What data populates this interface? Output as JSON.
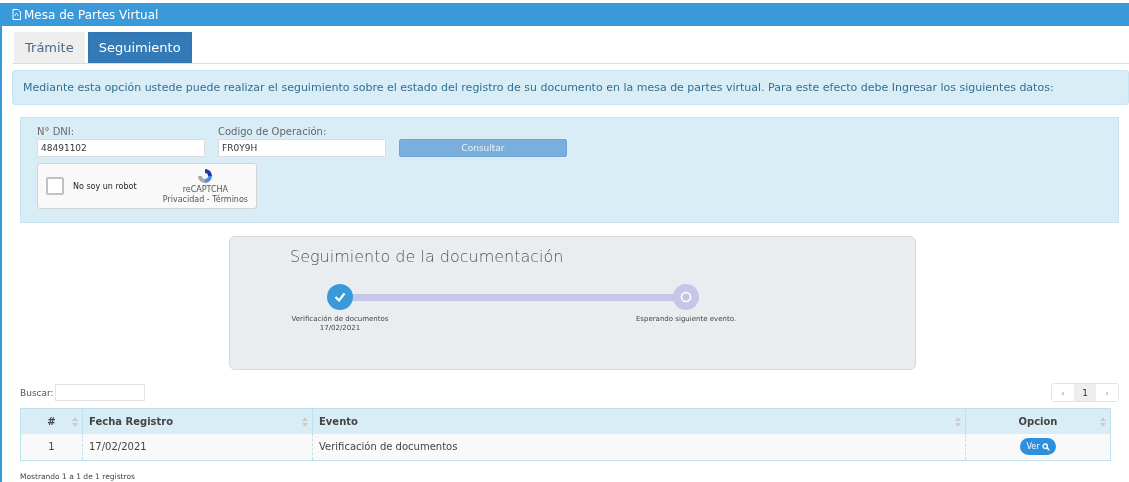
{
  "window": {
    "title": "Mesa de Partes Virtual"
  },
  "tabs": [
    {
      "label": "Trámite",
      "selected": false
    },
    {
      "label": "Seguimiento",
      "selected": true
    }
  ],
  "info": "Mediante esta opción ustede puede realizar el seguimiento sobre el estado del registro de su documento en la mesa de partes virtual. Para este efecto debe Ingresar los siguientes datos:",
  "form": {
    "dni": {
      "label": "N° DNI:",
      "value": "48491102"
    },
    "code": {
      "label": "Codigo de Operación:",
      "value": "FR0Y9H"
    },
    "button": "Consultar",
    "captcha": {
      "label": "No soy un robot",
      "checked": false,
      "brand": "reCAPTCHA",
      "links": "Privacidad - Términos"
    }
  },
  "tracking": {
    "title": "Seguimiento de la documentación",
    "steps": [
      {
        "kind": "done",
        "label": "Verificación de documentos",
        "date": "17/02/2021"
      },
      {
        "kind": "pending",
        "label": "Esperando siguiente evento."
      }
    ]
  },
  "search": {
    "label": "Buscar:"
  },
  "pagination": {
    "prev": "‹",
    "next": "›",
    "pages": [
      {
        "label": "1",
        "selected": true
      }
    ]
  },
  "table": {
    "columns": [
      {
        "label": "#"
      },
      {
        "label": "Fecha Registro"
      },
      {
        "label": "Evento"
      },
      {
        "label": "Opcion"
      }
    ],
    "rows": [
      {
        "cells": [
          "1",
          "17/02/2021",
          "Verificación de documentos"
        ],
        "action": "Ver"
      }
    ]
  },
  "status": "Mostrando 1 a 1 de 1 registros"
}
